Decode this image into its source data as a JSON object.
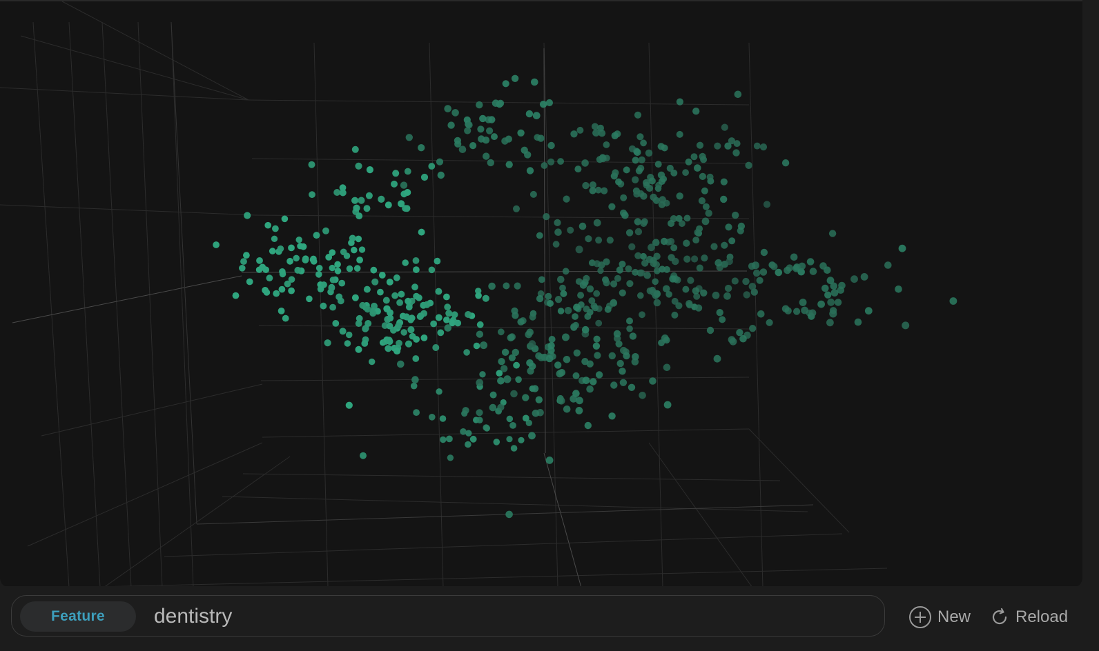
{
  "search": {
    "mode_label": "Feature",
    "query_value": "dentistry",
    "placeholder": ""
  },
  "actions": {
    "new_label": "New",
    "new_icon": "plus-circle-icon",
    "reload_label": "Reload",
    "reload_icon": "reload-icon"
  },
  "colors": {
    "background": "#141414",
    "panel": "#1c1c1c",
    "point_highlight": "#2fa57e",
    "point_dim": "#285a4a",
    "grid": "#2c2c2c",
    "axis": "#4a4a4a",
    "accent_text": "#3d9fbd"
  },
  "chart_data": {
    "type": "scatter",
    "title": "",
    "xlabel": "",
    "ylabel": "",
    "zlabel": "",
    "grid": true,
    "legend": "none",
    "clusters": [
      {
        "cx": -0.78,
        "cy": 0.05,
        "cz": 0.2,
        "spread": 0.09,
        "count": 70,
        "weight": 0.95
      },
      {
        "cx": -0.45,
        "cy": -0.18,
        "cz": 0.1,
        "spread": 0.11,
        "count": 110,
        "weight": 0.9
      },
      {
        "cx": -0.55,
        "cy": 0.35,
        "cz": 0.0,
        "spread": 0.1,
        "count": 30,
        "weight": 0.85
      },
      {
        "cx": -0.15,
        "cy": 0.6,
        "cz": -0.2,
        "spread": 0.09,
        "count": 45,
        "weight": 0.45
      },
      {
        "cx": 0.0,
        "cy": -0.35,
        "cz": -0.3,
        "spread": 0.14,
        "count": 90,
        "weight": 0.4
      },
      {
        "cx": 0.3,
        "cy": 0.45,
        "cz": -0.1,
        "spread": 0.13,
        "count": 110,
        "weight": 0.3
      },
      {
        "cx": 0.35,
        "cy": 0.0,
        "cz": -0.2,
        "spread": 0.15,
        "count": 130,
        "weight": 0.25
      },
      {
        "cx": 0.15,
        "cy": -0.1,
        "cz": 0.1,
        "spread": 0.12,
        "count": 60,
        "weight": 0.3
      },
      {
        "cx": 0.72,
        "cy": -0.05,
        "cz": -0.4,
        "spread": 0.1,
        "count": 45,
        "weight": 0.3
      },
      {
        "cx": -0.2,
        "cy": -0.65,
        "cz": 0.3,
        "spread": 0.11,
        "count": 35,
        "weight": 0.6
      }
    ]
  }
}
